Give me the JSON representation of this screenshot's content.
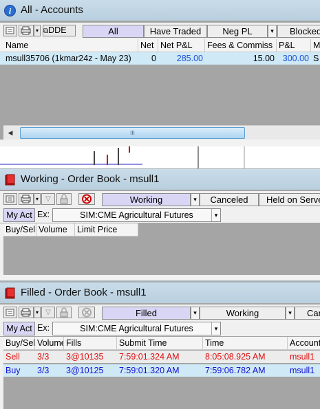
{
  "accounts": {
    "title": "All - Accounts",
    "toolbar": {
      "dde_label": "DDE"
    },
    "tabs": [
      {
        "label": "All",
        "selected": true
      },
      {
        "label": "Have Traded",
        "selected": false
      },
      {
        "label": "Neg PL",
        "selected": false
      },
      {
        "label": "Blocked",
        "selected": false
      }
    ],
    "columns": [
      "Name",
      "Net",
      "Net P&L",
      "Fees & Commiss",
      "P&L",
      "M"
    ],
    "rows": [
      {
        "name": "msull35706 (1kmar24z - May 23)",
        "net": "0",
        "net_pl": "285.00",
        "fees": "15.00",
        "pl": "300.00",
        "m": "S"
      }
    ],
    "scrollbar_grip": "III"
  },
  "working_book": {
    "title": "Working - Order Book - msull1",
    "tabs": [
      {
        "label": "Working",
        "selected": true
      },
      {
        "label": "Canceled",
        "selected": false
      },
      {
        "label": "Held on Server",
        "selected": false
      }
    ],
    "my_act_label": "My Act",
    "ex_label": "Ex:",
    "exchange": "SIM:CME Agricultural Futures",
    "columns": [
      "Buy/Sell",
      "Volume",
      "Limit Price"
    ]
  },
  "filled_book": {
    "title": "Filled - Order Book - msull1",
    "tabs": [
      {
        "label": "Filled",
        "selected": true
      },
      {
        "label": "Working",
        "selected": false
      },
      {
        "label": "Canceled",
        "selected": false
      }
    ],
    "my_act_label": "My Act",
    "ex_label": "Ex:",
    "exchange": "SIM:CME Agricultural Futures",
    "columns": [
      "Buy/Sell",
      "Volume",
      "Fills",
      "Submit Time",
      "Time",
      "Account"
    ],
    "rows": [
      {
        "side": "Sell",
        "volume": "3/3",
        "fills": "3@10135",
        "submit_time": "7:59:01.324 AM",
        "time": "8:05:08.925 AM",
        "account": "msull1"
      },
      {
        "side": "Buy",
        "volume": "3/3",
        "fills": "3@10125",
        "submit_time": "7:59:01.320 AM",
        "time": "7:59:06.782 AM",
        "account": "msull1"
      }
    ]
  },
  "colors": {
    "sell": "#e01010",
    "buy": "#1010d0",
    "selected_tab": "#d9d6f5",
    "selected_row": "#cfe9f6",
    "link_blue": "#1a4fd6"
  }
}
